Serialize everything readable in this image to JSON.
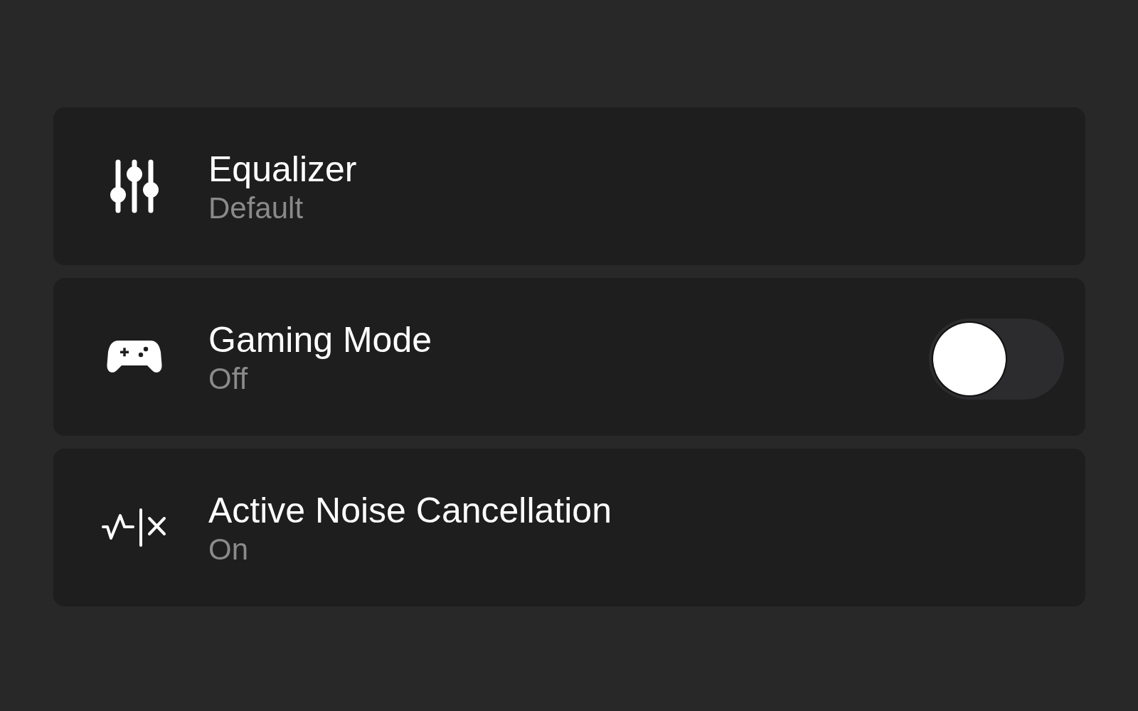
{
  "settings": [
    {
      "kind": "link",
      "title": "Equalizer",
      "value": "Default"
    },
    {
      "kind": "toggle",
      "title": "Gaming Mode",
      "value": "Off",
      "on": false
    },
    {
      "kind": "link",
      "title": "Active Noise Cancellation",
      "value": "On"
    }
  ]
}
